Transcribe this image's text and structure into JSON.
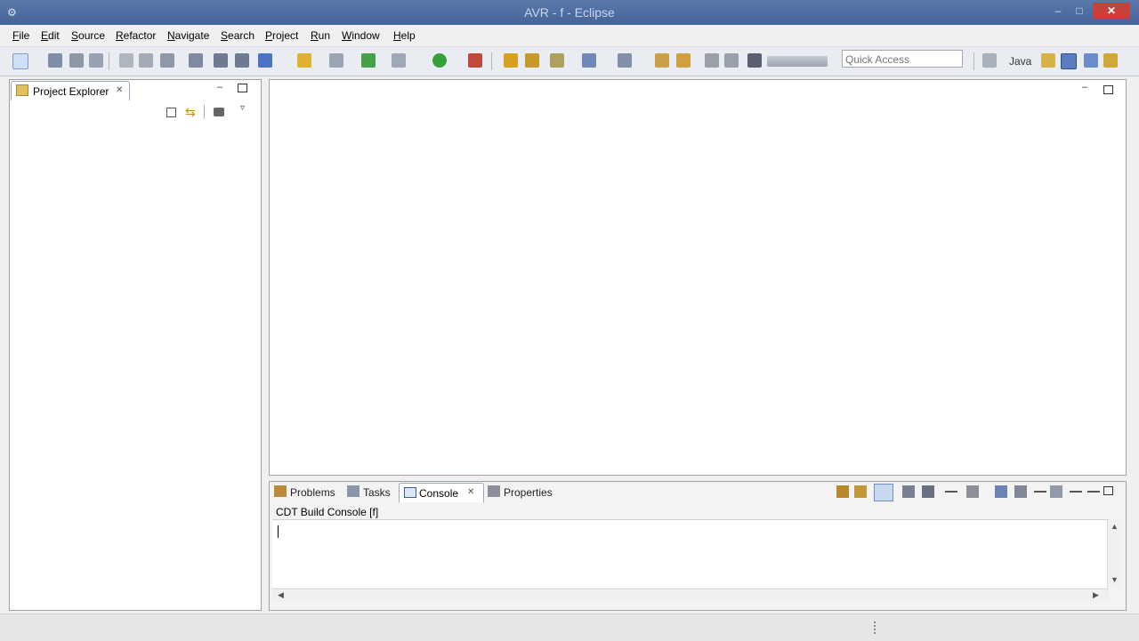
{
  "window": {
    "title": "AVR - f - Eclipse",
    "app_icon": "eclipse-icon",
    "minimize": "–",
    "maximize": "□",
    "close": "✕"
  },
  "menu": [
    "File",
    "Edit",
    "Source",
    "Refactor",
    "Navigate",
    "Search",
    "Project",
    "Run",
    "Window",
    "Help"
  ],
  "toolbar": {
    "quick_access_placeholder": "Quick Access",
    "perspective_label": "Java"
  },
  "project_explorer": {
    "tab_label": "Project Explorer",
    "close": "✕"
  },
  "bottom_panel": {
    "tabs": [
      "Problems",
      "Tasks",
      "Console",
      "Properties"
    ],
    "active_tab": "Console",
    "console_title": "CDT Build Console [f]"
  },
  "colors": {
    "titlebar": "#4c6a9c",
    "close_button": "#c9403a",
    "active_tab_border": "#9aa7c0"
  }
}
